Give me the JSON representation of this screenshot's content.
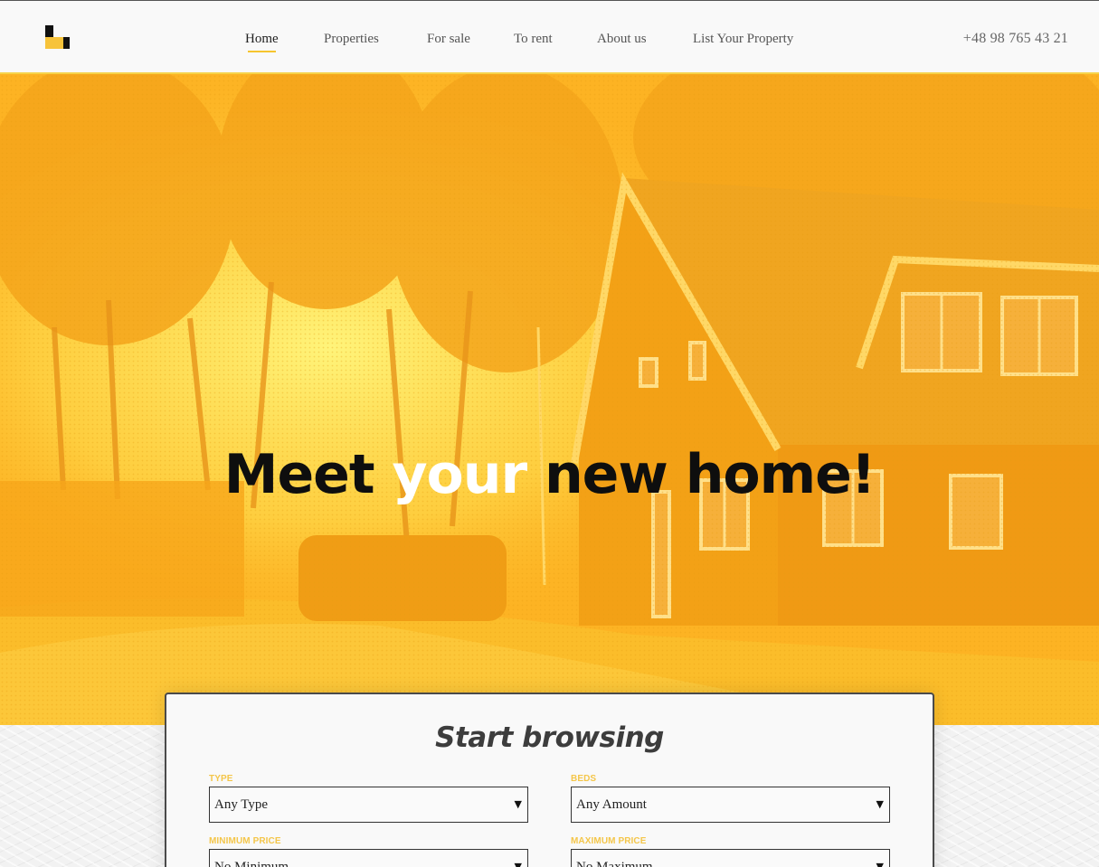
{
  "header": {
    "nav": [
      {
        "label": "Home",
        "active": true
      },
      {
        "label": "Properties",
        "active": false
      },
      {
        "label": "For sale",
        "active": false
      },
      {
        "label": "To rent",
        "active": false
      },
      {
        "label": "About us",
        "active": false
      },
      {
        "label": "List Your Property",
        "active": false
      }
    ],
    "phone": "+48 98 765 43 21"
  },
  "hero": {
    "title_part1": "Meet ",
    "title_highlight": "your",
    "title_part2": " new home!"
  },
  "search": {
    "title": "Start browsing",
    "type_label": "TYPE",
    "type_value": "Any Type",
    "beds_label": "BEDS",
    "beds_value": "Any Amount",
    "min_price_label": "MINIMUM PRICE",
    "min_price_value": "No Minimum",
    "max_price_label": "MAXIMUM PRICE",
    "max_price_value": "No Maximum"
  },
  "colors": {
    "accent": "#f6c52f",
    "hero_overlay": "#fdb323",
    "title_dark": "#0e0e0e"
  },
  "icons": {
    "logo": "logo-icon",
    "select_arrow": "triangle-down-icon"
  }
}
